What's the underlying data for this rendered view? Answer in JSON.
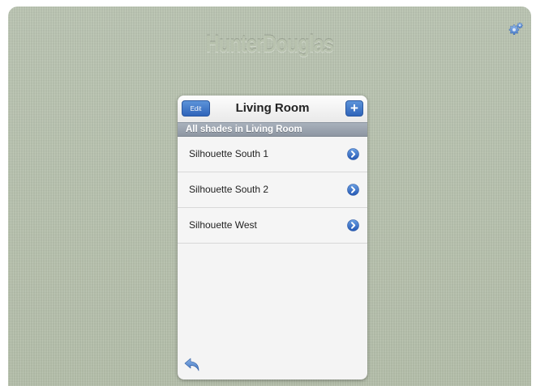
{
  "app": {
    "brand": "HunterDouglas"
  },
  "header": {
    "edit_label": "Edit",
    "title": "Living Room",
    "add_label": "+"
  },
  "section": {
    "title": "All shades in Living Room"
  },
  "shades": [
    {
      "name": "Silhouette South 1"
    },
    {
      "name": "Silhouette South 2"
    },
    {
      "name": "Silhouette West"
    }
  ],
  "icons": {
    "settings": "gear-icon",
    "disclosure": "chevron-right-circle-icon",
    "back": "back-arrow-icon"
  },
  "colors": {
    "background": "#b9c3b0",
    "accent": "#2f64ba",
    "section_header": "#98a0ab"
  }
}
